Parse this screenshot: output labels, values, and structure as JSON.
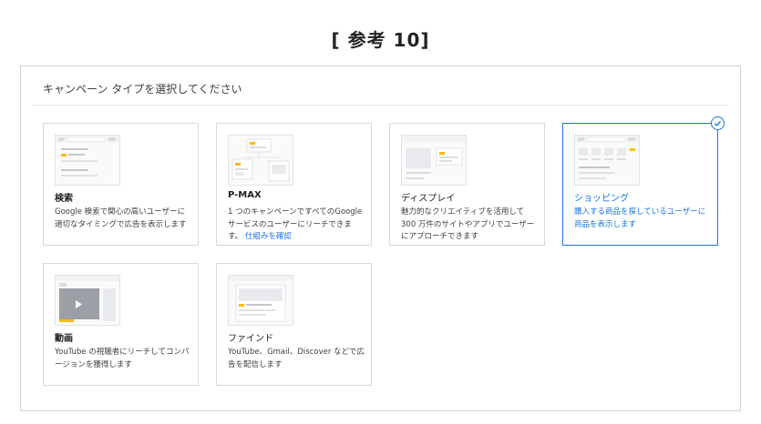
{
  "page": {
    "reference_title": "[ 参考 10]"
  },
  "panel": {
    "heading": "キャンペーン タイプを選択してください"
  },
  "cards": [
    {
      "title": "検索",
      "description": "Google 検索で関心の高いユーザーに適切なタイミングで広告を表示します",
      "icon": "search-ad-thumbnail"
    },
    {
      "title": "P-MAX",
      "description": "1 つのキャンペーンですべてのGoogle サービスのユーザーにリーチできます。",
      "link": "仕組みを確認",
      "icon": "performance-max-thumbnail"
    },
    {
      "title": "ディスプレイ",
      "description": "魅力的なクリエイティブを活用して 300 万件のサイトやアプリでユーザーにアプローチできます",
      "icon": "display-ad-thumbnail"
    },
    {
      "title": "ショッピング",
      "description": "購入する商品を探しているユーザーに商品を表示します",
      "icon": "shopping-ad-thumbnail",
      "selected": true
    },
    {
      "title": "動画",
      "description": "YouTube の視聴者にリーチしてコンバージョンを獲得します",
      "icon": "video-ad-thumbnail"
    },
    {
      "title": "ファインド",
      "description": "YouTube、Gmail、Discover などで広告を配信します",
      "icon": "discovery-ad-thumbnail"
    }
  ],
  "colors": {
    "accent": "#1a73e8",
    "highlight": "#fbbc04"
  }
}
